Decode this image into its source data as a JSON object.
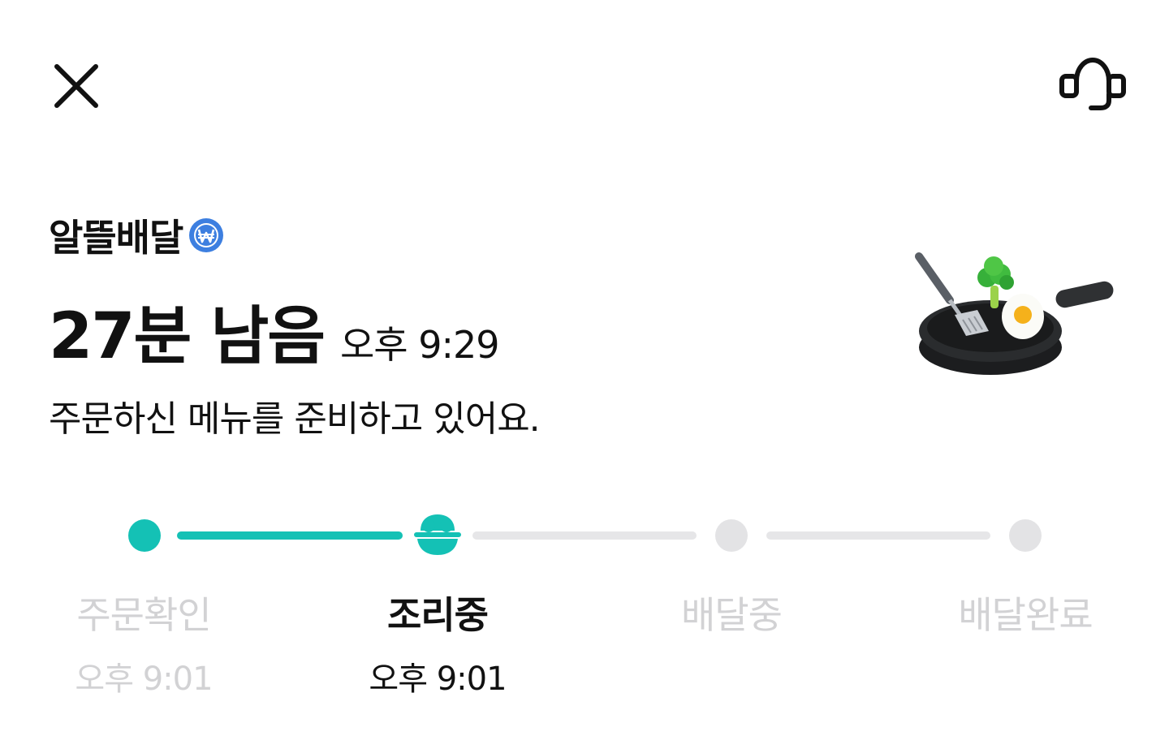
{
  "header": {
    "close_icon": "close-icon",
    "support_icon": "headset-icon"
  },
  "store": {
    "brand_name": "알뜰배달",
    "badge_icon": "won-coin-badge-icon",
    "badge_color": "#3d7fe0"
  },
  "eta": {
    "remaining": "27분 남음",
    "arrival_time": "오후 9:29",
    "message": "주문하신 메뉴를 준비하고 있어요.",
    "illustration": "frying-pan-cooking-icon"
  },
  "progress": {
    "accent_color": "#14c1b5",
    "inactive_color": "#e3e3e5",
    "current_step_index": 1,
    "steps": [
      {
        "label": "주문확인",
        "time": "오후 9:01",
        "state": "done"
      },
      {
        "label": "조리중",
        "time": "오후 9:01",
        "state": "active",
        "icon": "rice-bowl-icon"
      },
      {
        "label": "배달중",
        "time": "",
        "state": "pending"
      },
      {
        "label": "배달완료",
        "time": "",
        "state": "pending"
      }
    ]
  }
}
